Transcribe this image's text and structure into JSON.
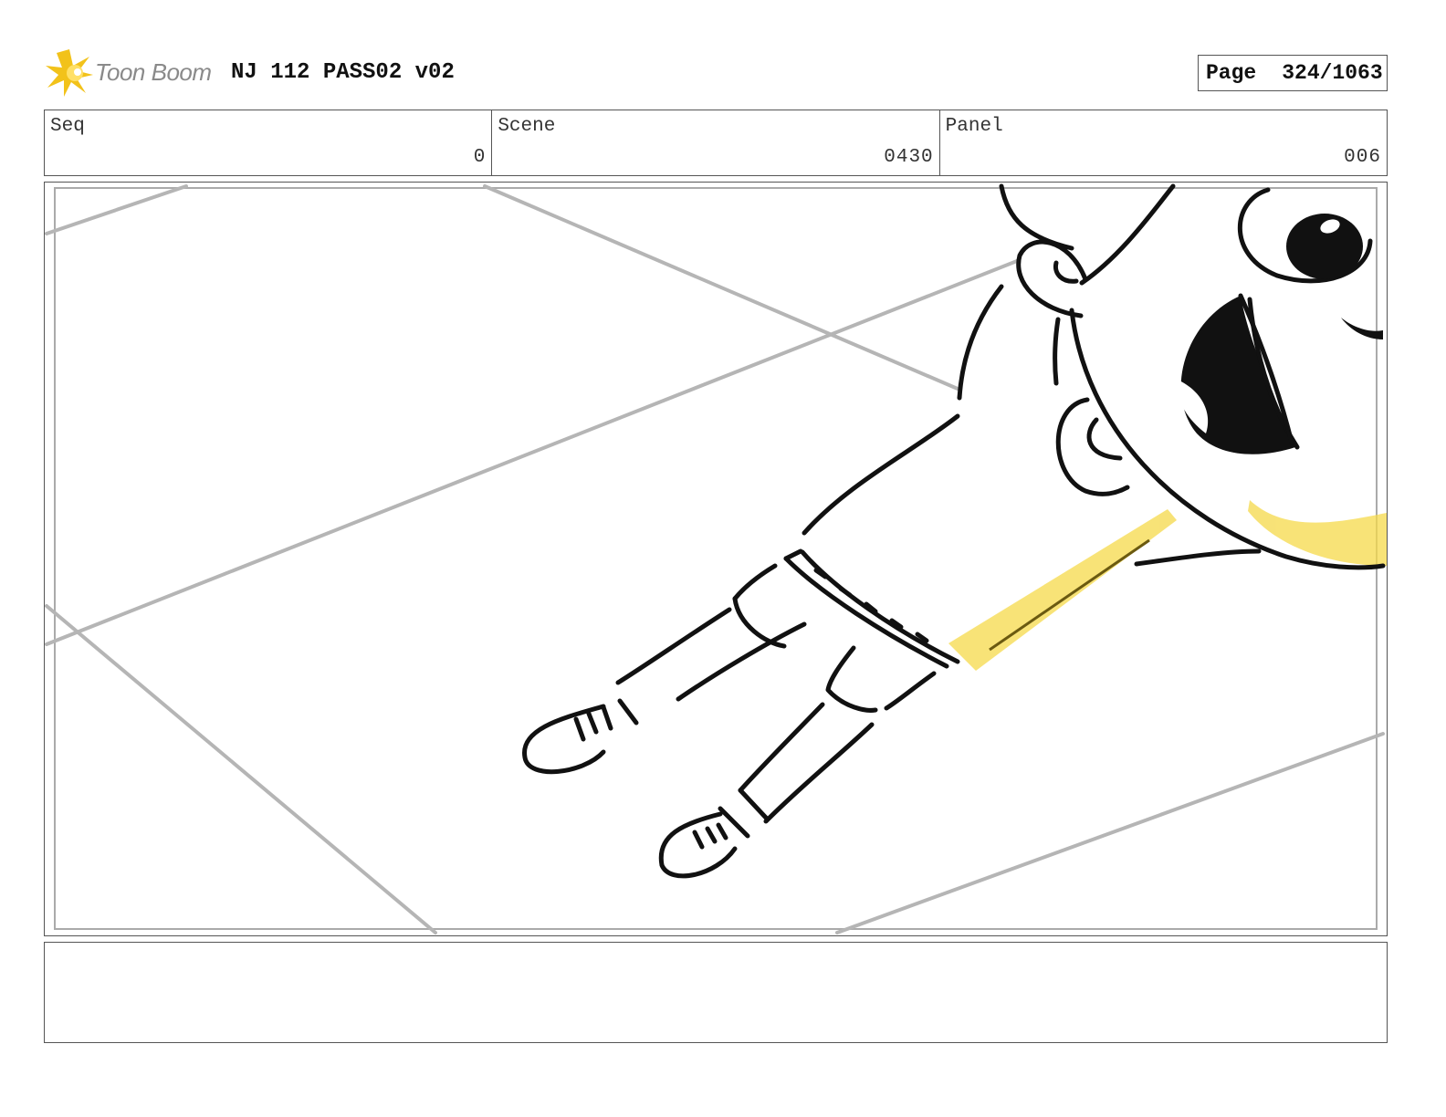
{
  "header": {
    "logo_text": "Toon Boom",
    "logo_icon": "toon-boom-star-icon",
    "title": "NJ 112 PASS02 v02",
    "page_label": "Page",
    "page_number": "324/1063"
  },
  "info": {
    "seq_label": "Seq",
    "seq_value": "0",
    "scene_label": "Scene",
    "scene_value": "0430",
    "panel_label": "Panel",
    "panel_value": "006"
  },
  "colors": {
    "accent_yellow": "#f5d94a",
    "line_black": "#111111",
    "guide_gray": "#b5b5b5",
    "border": "#555555"
  },
  "notes": {
    "text": ""
  }
}
